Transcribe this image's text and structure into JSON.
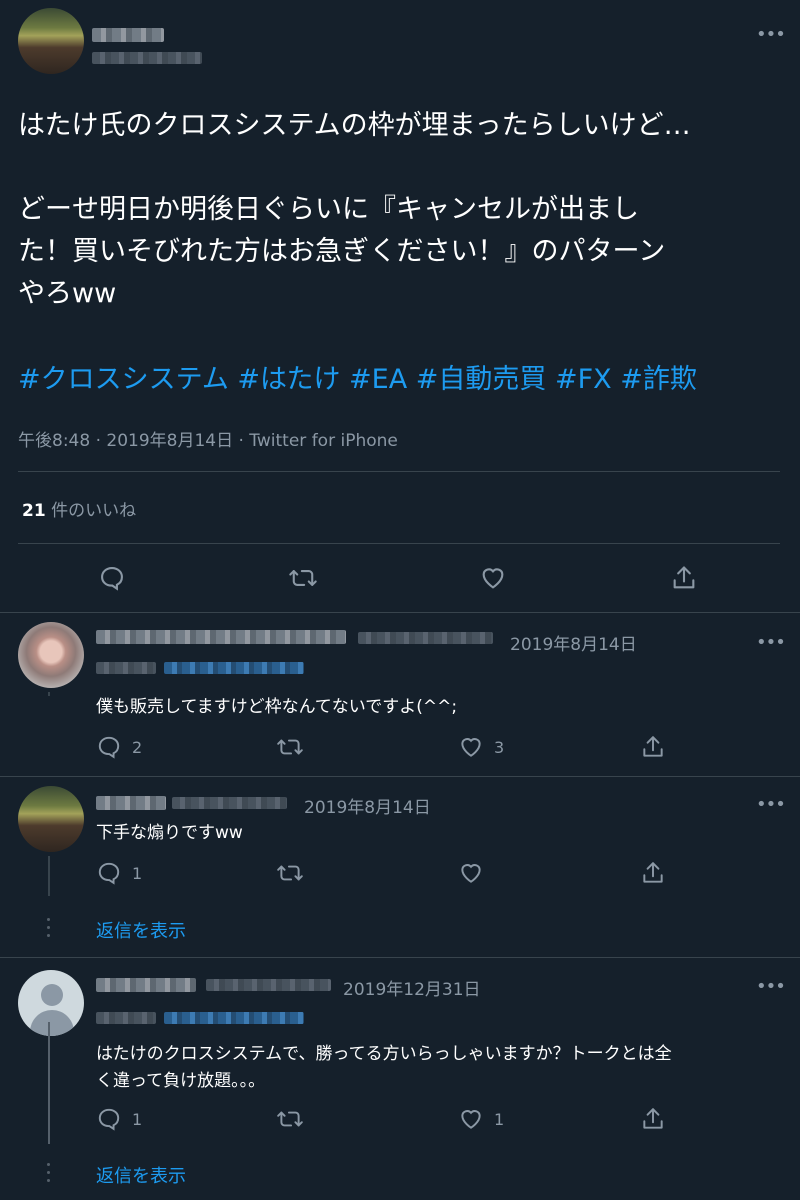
{
  "main_tweet": {
    "text_line1": "はたけ氏のクロスシステムの枠が埋まったらしいけど…",
    "text_line2": "どーせ明日か明後日ぐらいに『キャンセルが出まし",
    "text_line3": "た！買いそびれた方はお急ぎください！』のパターン",
    "text_line4": "やろww",
    "hashtags": "#クロスシステム #はたけ #EA #自動売買 #FX #詐欺",
    "meta": "午後8:48 · 2019年8月14日 · Twitter for iPhone",
    "likes_count": "21",
    "likes_label": " 件のいいね"
  },
  "replies": [
    {
      "date": "2019年8月14日",
      "text": "僕も販売してますけど枠なんてないですよ(^^;",
      "reply_count": "2",
      "retweet_count": "",
      "like_count": "3"
    },
    {
      "date": "2019年8月14日",
      "text": "下手な煽りですww",
      "reply_count": "1",
      "retweet_count": "",
      "like_count": "",
      "show_replies": "返信を表示"
    },
    {
      "date": "2019年12月31日",
      "text_line1": "はたけのクロスシステムで、勝ってる方いらっしゃいますか？トークとは全",
      "text_line2": "く違って負け放題。。。",
      "reply_count": "1",
      "retweet_count": "",
      "like_count": "1",
      "show_replies": "返信を表示"
    }
  ],
  "icons": {
    "more": "more-icon",
    "reply": "reply-icon",
    "retweet": "retweet-icon",
    "like": "heart-icon",
    "share": "share-icon"
  },
  "colors": {
    "background": "#15202b",
    "link": "#1d9bf0",
    "secondary": "#8b98a5"
  }
}
